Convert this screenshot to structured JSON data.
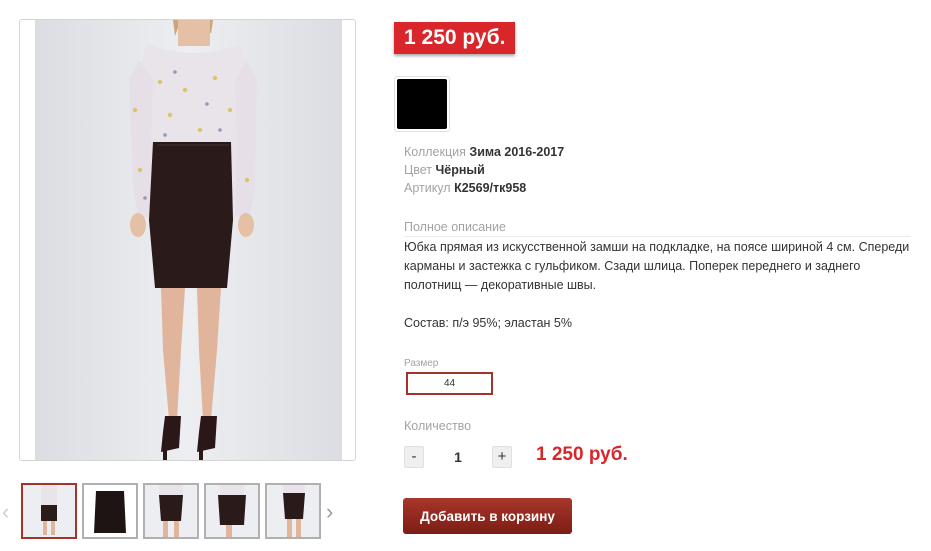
{
  "product": {
    "price_badge": "1 250 руб.",
    "color_swatch": {
      "color": "#000000"
    },
    "attributes": [
      {
        "label": "Коллекция",
        "value": "Зима 2016-2017"
      },
      {
        "label": "Цвет",
        "value": "Чёрный"
      },
      {
        "label": "Артикул",
        "value": "К2569/тк958"
      }
    ],
    "description": {
      "label": "Полное описание",
      "text": "Юбка прямая из искусственной замши на подкладке, на поясе шириной 4 см. Спереди карманы и застежка с гульфиком. Сзади шлица. Поперек переднего и заднего полотнищ — декоративные швы.",
      "composition": "Состав: п/э 95%; эластан 5%"
    },
    "size": {
      "label": "Размер",
      "options": [
        "44"
      ]
    },
    "quantity": {
      "label": "Количество",
      "minus": "-",
      "value": "1",
      "plus": "+"
    },
    "total_price": "1 250 руб.",
    "add_to_cart": "Добавить в корзину"
  },
  "gallery": {
    "prev_arrow": "‹",
    "next_arrow": "›",
    "thumbnails": [
      "full-look-front",
      "skirt-flat",
      "skirt-front",
      "skirt-side",
      "skirt-back"
    ],
    "active_thumbnail": 0
  },
  "colors": {
    "accent_red": "#d8262a",
    "button_dark_red": "#8b2419",
    "border_red": "#a3342a"
  }
}
